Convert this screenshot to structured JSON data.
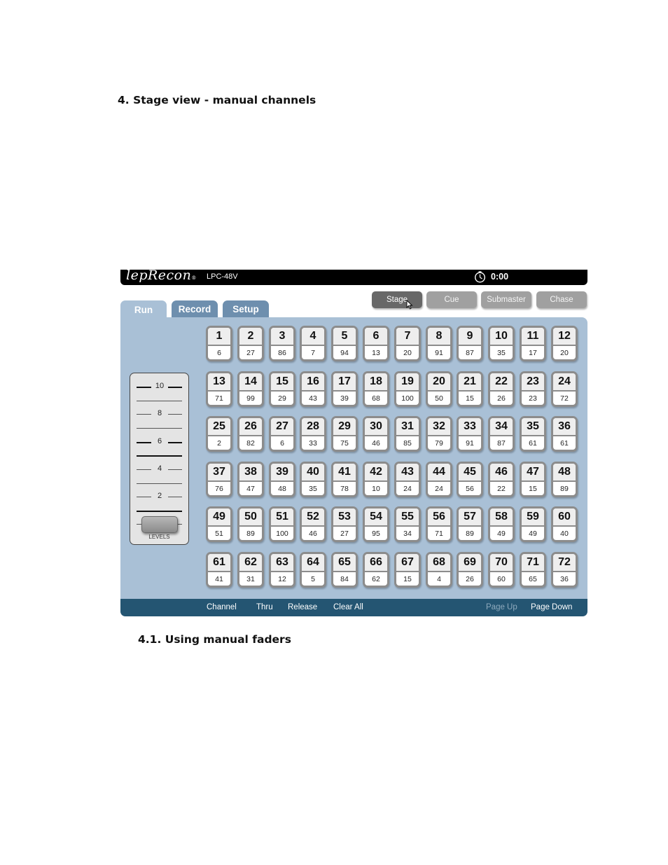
{
  "document": {
    "heading": "4. Stage view - manual channels",
    "subheading": "4.1. Using manual faders"
  },
  "app": {
    "brand": "lepRecon",
    "brand_mark": "®",
    "model": "LPC-48V",
    "clock_icon": "stopwatch-icon",
    "time": "0:00",
    "mode_buttons": [
      {
        "label": "Stage",
        "active": true
      },
      {
        "label": "Cue",
        "active": false
      },
      {
        "label": "Submaster",
        "active": false
      },
      {
        "label": "Chase",
        "active": false
      }
    ],
    "tabs": [
      {
        "label": "Run",
        "active": true
      },
      {
        "label": "Record",
        "active": false
      },
      {
        "label": "Setup",
        "active": false
      }
    ],
    "fader": {
      "scale_labels": [
        "10",
        "8",
        "6",
        "4",
        "2"
      ],
      "label": "LEVELS",
      "level_fraction": 0
    },
    "channels": [
      {
        "n": "1",
        "v": "6"
      },
      {
        "n": "2",
        "v": "27"
      },
      {
        "n": "3",
        "v": "86"
      },
      {
        "n": "4",
        "v": "7"
      },
      {
        "n": "5",
        "v": "94"
      },
      {
        "n": "6",
        "v": "13"
      },
      {
        "n": "7",
        "v": "20"
      },
      {
        "n": "8",
        "v": "91"
      },
      {
        "n": "9",
        "v": "87"
      },
      {
        "n": "10",
        "v": "35"
      },
      {
        "n": "11",
        "v": "17"
      },
      {
        "n": "12",
        "v": "20"
      },
      {
        "n": "13",
        "v": "71"
      },
      {
        "n": "14",
        "v": "99"
      },
      {
        "n": "15",
        "v": "29"
      },
      {
        "n": "16",
        "v": "43"
      },
      {
        "n": "17",
        "v": "39"
      },
      {
        "n": "18",
        "v": "68"
      },
      {
        "n": "19",
        "v": "100"
      },
      {
        "n": "20",
        "v": "50"
      },
      {
        "n": "21",
        "v": "15"
      },
      {
        "n": "22",
        "v": "26"
      },
      {
        "n": "23",
        "v": "23"
      },
      {
        "n": "24",
        "v": "72"
      },
      {
        "n": "25",
        "v": "2"
      },
      {
        "n": "26",
        "v": "82"
      },
      {
        "n": "27",
        "v": "6"
      },
      {
        "n": "28",
        "v": "33"
      },
      {
        "n": "29",
        "v": "75"
      },
      {
        "n": "30",
        "v": "46"
      },
      {
        "n": "31",
        "v": "85"
      },
      {
        "n": "32",
        "v": "79"
      },
      {
        "n": "33",
        "v": "91"
      },
      {
        "n": "34",
        "v": "87"
      },
      {
        "n": "35",
        "v": "61"
      },
      {
        "n": "36",
        "v": "61"
      },
      {
        "n": "37",
        "v": "76"
      },
      {
        "n": "38",
        "v": "47"
      },
      {
        "n": "39",
        "v": "48"
      },
      {
        "n": "40",
        "v": "35"
      },
      {
        "n": "41",
        "v": "78"
      },
      {
        "n": "42",
        "v": "10"
      },
      {
        "n": "43",
        "v": "24"
      },
      {
        "n": "44",
        "v": "24"
      },
      {
        "n": "45",
        "v": "56"
      },
      {
        "n": "46",
        "v": "22"
      },
      {
        "n": "47",
        "v": "15"
      },
      {
        "n": "48",
        "v": "89"
      },
      {
        "n": "49",
        "v": "51"
      },
      {
        "n": "50",
        "v": "89"
      },
      {
        "n": "51",
        "v": "100"
      },
      {
        "n": "52",
        "v": "46"
      },
      {
        "n": "53",
        "v": "27"
      },
      {
        "n": "54",
        "v": "95"
      },
      {
        "n": "55",
        "v": "34"
      },
      {
        "n": "56",
        "v": "71"
      },
      {
        "n": "57",
        "v": "89"
      },
      {
        "n": "58",
        "v": "49"
      },
      {
        "n": "59",
        "v": "49"
      },
      {
        "n": "60",
        "v": "40"
      },
      {
        "n": "61",
        "v": "41"
      },
      {
        "n": "62",
        "v": "31"
      },
      {
        "n": "63",
        "v": "12"
      },
      {
        "n": "64",
        "v": "5"
      },
      {
        "n": "65",
        "v": "84"
      },
      {
        "n": "66",
        "v": "62"
      },
      {
        "n": "67",
        "v": "15"
      },
      {
        "n": "68",
        "v": "4"
      },
      {
        "n": "69",
        "v": "26"
      },
      {
        "n": "70",
        "v": "60"
      },
      {
        "n": "71",
        "v": "65"
      },
      {
        "n": "72",
        "v": "36"
      }
    ],
    "bottom_bar": {
      "channel": "Channel",
      "thru": "Thru",
      "release": "Release",
      "clear_all": "Clear All",
      "page_up": "Page Up",
      "page_down": "Page Down"
    },
    "colors": {
      "panel": "#a9c0d6",
      "bottom_bar": "#245572",
      "active_mode": "#686868",
      "inactive_mode": "#a0a0a0"
    }
  }
}
